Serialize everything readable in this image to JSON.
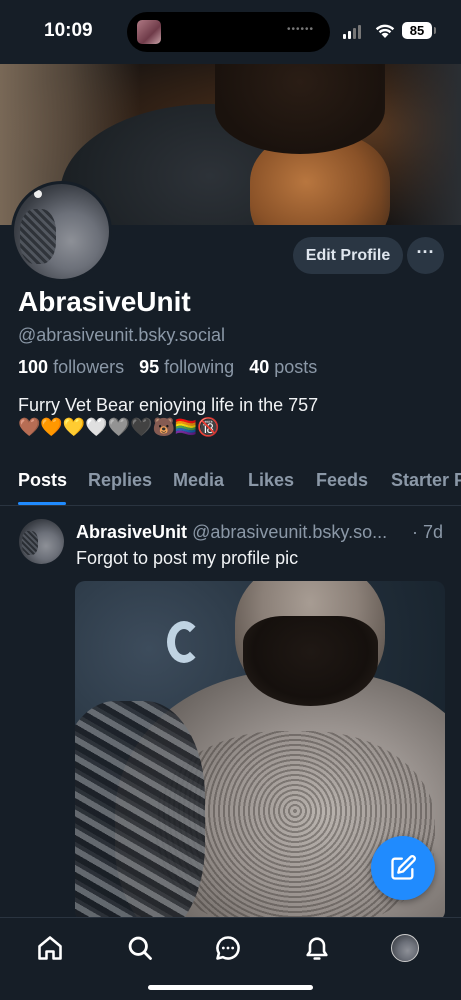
{
  "status_bar": {
    "time": "10:09",
    "battery": "85"
  },
  "profile": {
    "display_name": "AbrasiveUnit",
    "handle": "@abrasiveunit.bsky.social",
    "followers_count": "100",
    "followers_label": "followers",
    "following_count": "95",
    "following_label": "following",
    "posts_count": "40",
    "posts_label": "posts",
    "bio_line1": "Furry Vet Bear enjoying life in the 757",
    "bio_line2": "🤎🧡💛🤍🩶🖤🐻🏳️‍🌈🔞",
    "edit_label": "Edit Profile",
    "more_label": "···"
  },
  "tabs": [
    "Posts",
    "Replies",
    "Media",
    "Likes",
    "Feeds",
    "Starter P"
  ],
  "active_tab": "Posts",
  "post": {
    "author": "AbrasiveUnit",
    "handle": "@abrasiveunit.bsky.so...",
    "time": "· 7d",
    "text": "Forgot to post my profile pic"
  },
  "colors": {
    "background": "#161e27",
    "accent": "#208bfe",
    "muted_text": "#8b98a7",
    "button_bg": "#2a3643"
  },
  "icons": [
    "home-icon",
    "search-icon",
    "chat-icon",
    "bell-icon",
    "compose-icon"
  ]
}
